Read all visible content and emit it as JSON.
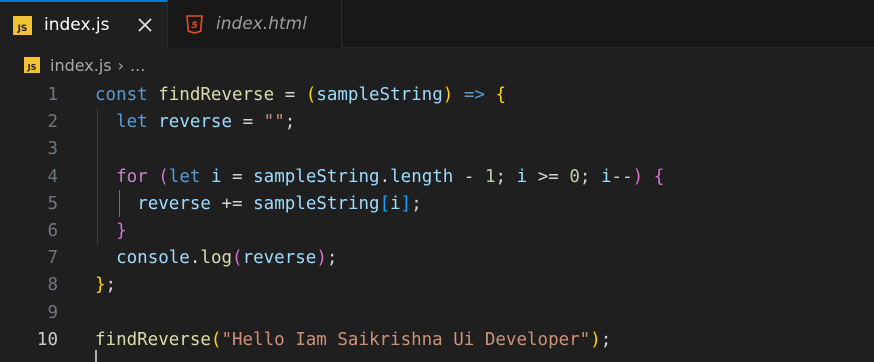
{
  "tabs": [
    {
      "icon": "JS",
      "label": "index.js",
      "active": true
    },
    {
      "icon": "5",
      "label": "index.html",
      "active": false
    }
  ],
  "breadcrumb": {
    "icon": "JS",
    "file": "index.js",
    "separator": "›",
    "rest": "..."
  },
  "code": {
    "line_numbers": [
      "1",
      "2",
      "3",
      "4",
      "5",
      "6",
      "7",
      "8",
      "9",
      "10"
    ],
    "lines": [
      "const findReverse = (sampleString) => {",
      "  let reverse = \"\";",
      "",
      "  for (let i = sampleString.length - 1; i >= 0; i--) {",
      "    reverse += sampleString[i];",
      "  }",
      "  console.log(reverse);",
      "};",
      "",
      "findReverse(\"Hello Iam Saikrishna Ui Developer\");"
    ]
  },
  "colors": {
    "background": "#1f1f1f",
    "tab_accent": "#0078d4",
    "keyword": "#569cd6",
    "control": "#c586c0",
    "function": "#dcdcaa",
    "variable": "#9cdcfe",
    "string": "#ce9178",
    "number": "#b5cea8"
  }
}
